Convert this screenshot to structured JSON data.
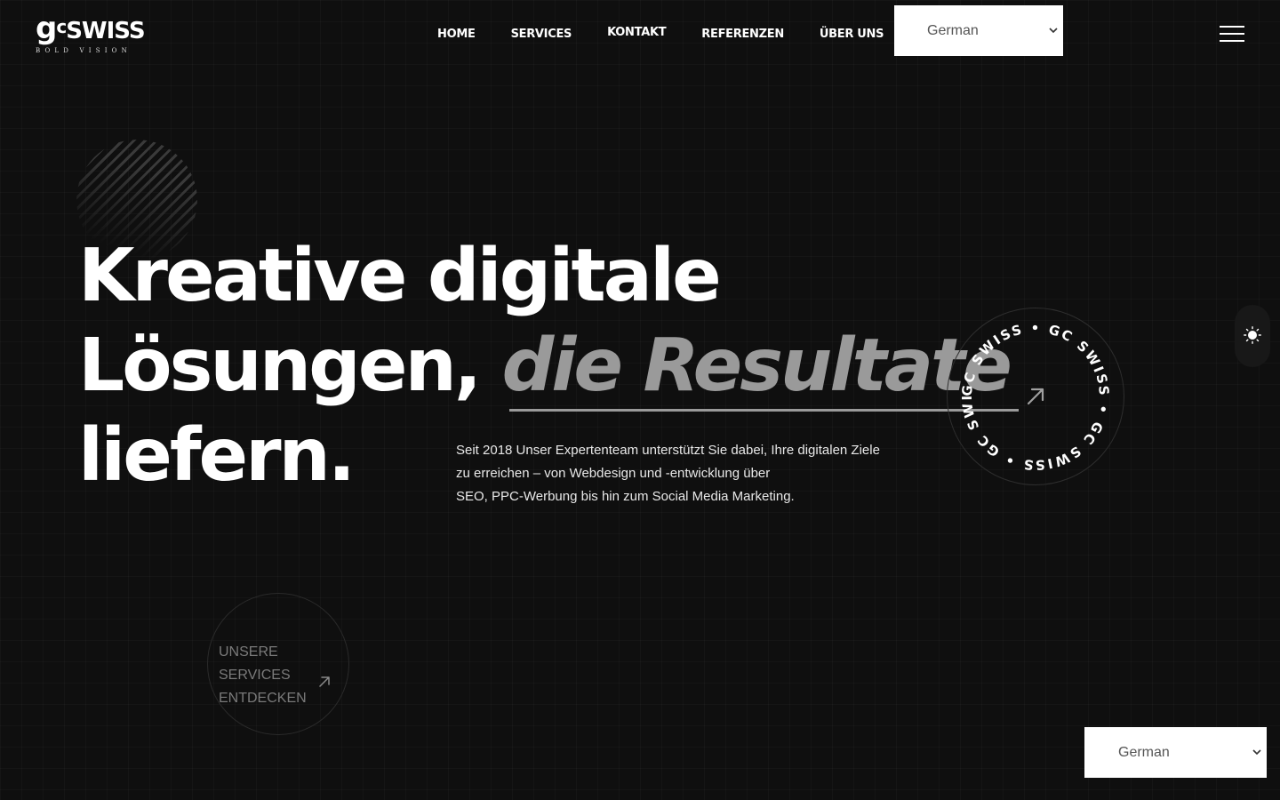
{
  "brand": {
    "logo_mark_g": "g",
    "logo_mark_c": "c",
    "logo_mark_text": "SWISS",
    "tagline": "BOLD VISION"
  },
  "nav": {
    "items": [
      {
        "label": "HOME"
      },
      {
        "label": "SERVICES"
      },
      {
        "label": "KONTAKT"
      },
      {
        "label": "REFERENZEN"
      },
      {
        "label": "ÜBER UNS"
      }
    ]
  },
  "language_select": {
    "selected": "German"
  },
  "language_select_floating": {
    "selected": "German"
  },
  "hero": {
    "line1": "Kreative digitale",
    "line2_plain": "Lösungen,",
    "line2_accent": "die Resultate",
    "line3": "liefern.",
    "description_lines": [
      "Seit 2018 Unser Expertenteam unterstützt Sie dabei, Ihre digitalen Ziele",
      "zu erreichen – von Webdesign und -entwicklung über",
      "SEO, PPC-Werbung bis hin zum Social Media Marketing."
    ]
  },
  "rotating_badge": {
    "text": "GC SWISS • GC SWISS • GC SWISS • GC SWISS • ",
    "icon": "arrow-up-right-icon"
  },
  "cta": {
    "line1": "UNSERE SERVICES",
    "line2": "ENTDECKEN",
    "icon": "arrow-up-right-icon"
  },
  "theme_toggle": {
    "icon": "sun-icon"
  },
  "colors": {
    "background": "#0f0f0f",
    "accent_gray": "#9a9a9a",
    "text": "#ffffff"
  }
}
